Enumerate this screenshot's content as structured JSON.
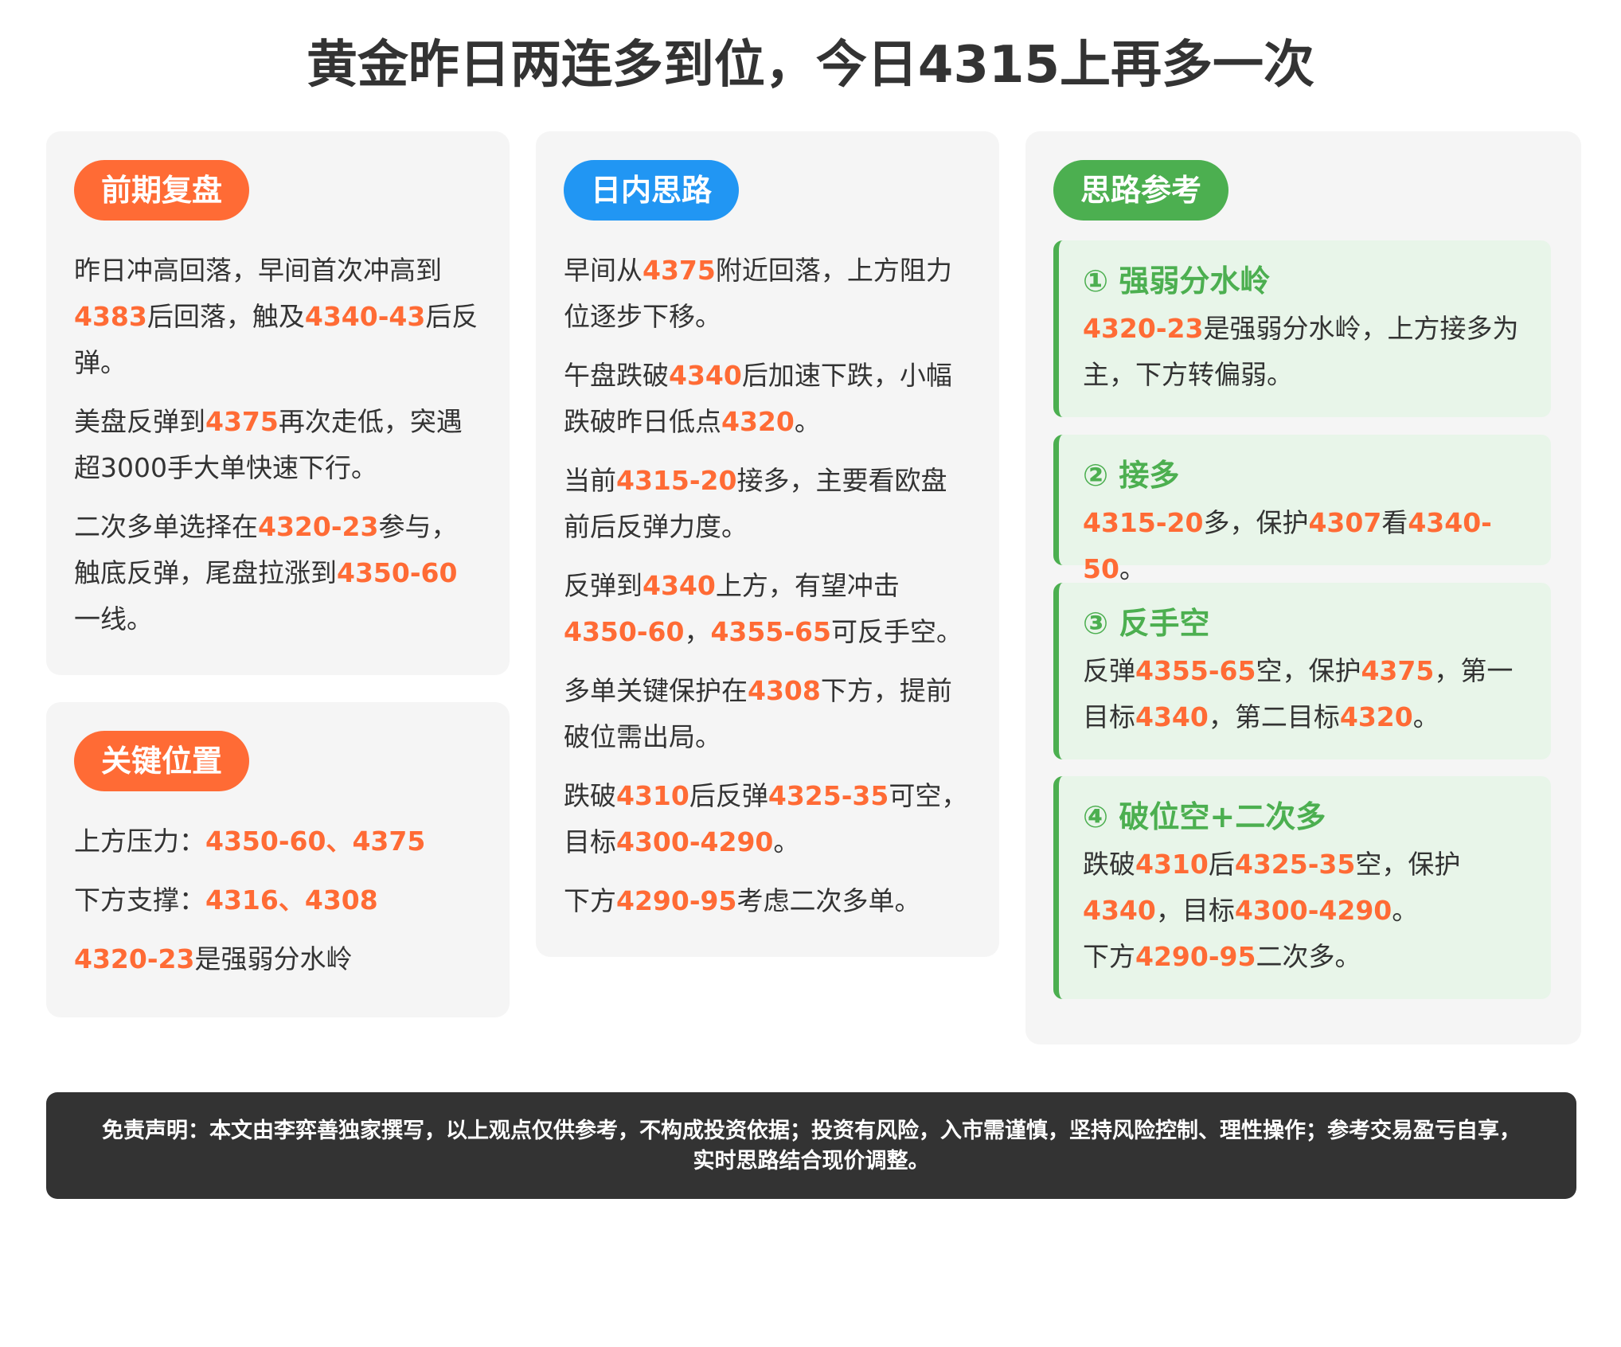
{
  "title": "黄金昨日两连多到位，今日4315上再多一次",
  "colors": {
    "highlight": "#ff6b35",
    "orange_badge": "#ff6b35",
    "blue_badge": "#2196f3",
    "green": "#4caf50",
    "card_bg": "#f5f5f5",
    "strategy_bg": "#e8f5e9",
    "disclaimer_bg": "#333333"
  },
  "review": {
    "badge": "前期复盘",
    "p1": {
      "a": "昨日冲高回落，早间首次冲高到",
      "b": "4383",
      "c": "后回落，触及",
      "d": "4340-43",
      "e": "后反弹。"
    },
    "p2": {
      "a": "美盘反弹到",
      "b": "4375",
      "c": "再次走低，突遇超3000手大单快速下行。"
    },
    "p3": {
      "a": "二次多单选择在",
      "b": "4320-23",
      "c": "参与，触底反弹，尾盘拉涨到",
      "d": "4350-60",
      "e": "一线。"
    }
  },
  "levels": {
    "badge": "关键位置",
    "resistance_label": "上方压力：",
    "resistance_1": "4350-60",
    "sep1": "、",
    "resistance_2": "4375",
    "support_label": "下方支撑：",
    "support_1": "4316",
    "sep2": "、",
    "support_2": "4308",
    "watershed_value": "4320-23",
    "watershed_text": "是强弱分水岭"
  },
  "intraday": {
    "badge": "日内思路",
    "p1": {
      "a": "早间从",
      "b": "4375",
      "c": "附近回落，上方阻力位逐步下移。"
    },
    "p2": {
      "a": "午盘跌破",
      "b": "4340",
      "c": "后加速下跌，小幅跌破昨日低点",
      "d": "4320",
      "e": "。"
    },
    "p3": {
      "a": "当前",
      "b": "4315-20",
      "c": "接多，主要看欧盘前后反弹力度。"
    },
    "p4": {
      "a": "反弹到",
      "b": "4340",
      "c": "上方，有望冲击",
      "d": "4350-60",
      "e": "，",
      "f": "4355-65",
      "g": "可反手空。"
    },
    "p5": {
      "a": "多单关键保护在",
      "b": "4308",
      "c": "下方，提前破位需出局。"
    },
    "p6": {
      "a": "跌破",
      "b": "4310",
      "c": "后反弹",
      "d": "4325-35",
      "e": "可空，目标",
      "f": "4300-4290",
      "g": "。"
    },
    "p7": {
      "a": "下方",
      "b": "4290-95",
      "c": "考虑二次多单。"
    }
  },
  "reference": {
    "badge": "思路参考",
    "s1": {
      "title": "① 强弱分水岭",
      "a": "4320-23",
      "b": "是强弱分水岭，上方接多为主，下方转偏弱。"
    },
    "s2": {
      "title": "② 接多",
      "a": "4315-20",
      "b": "多，保护",
      "c": "4307",
      "d": "看",
      "e": "4340-50",
      "f": "。"
    },
    "s3": {
      "title": "③ 反手空",
      "a": "反弹",
      "b": "4355-65",
      "c": "空，保护",
      "d": "4375",
      "e": "，第一目标",
      "f": "4340",
      "g": "，第二目标",
      "h": "4320",
      "i": "。"
    },
    "s4": {
      "title": "④ 破位空+二次多",
      "a": "跌破",
      "b": "4310",
      "c": "后",
      "d": "4325-35",
      "e": "空，保护",
      "f": "4340",
      "g": "，目标",
      "h": "4300-4290",
      "i": "。",
      "j": "下方",
      "k": "4290-95",
      "l": "二次多。"
    }
  },
  "disclaimer": {
    "line1": "免责声明：本文由李弈善独家撰写，以上观点仅供参考，不构成投资依据；投资有风险，入市需谨慎，坚持风险控制、理性操作；参考交易盈亏自享，",
    "line2": "实时思路结合现价调整。"
  }
}
